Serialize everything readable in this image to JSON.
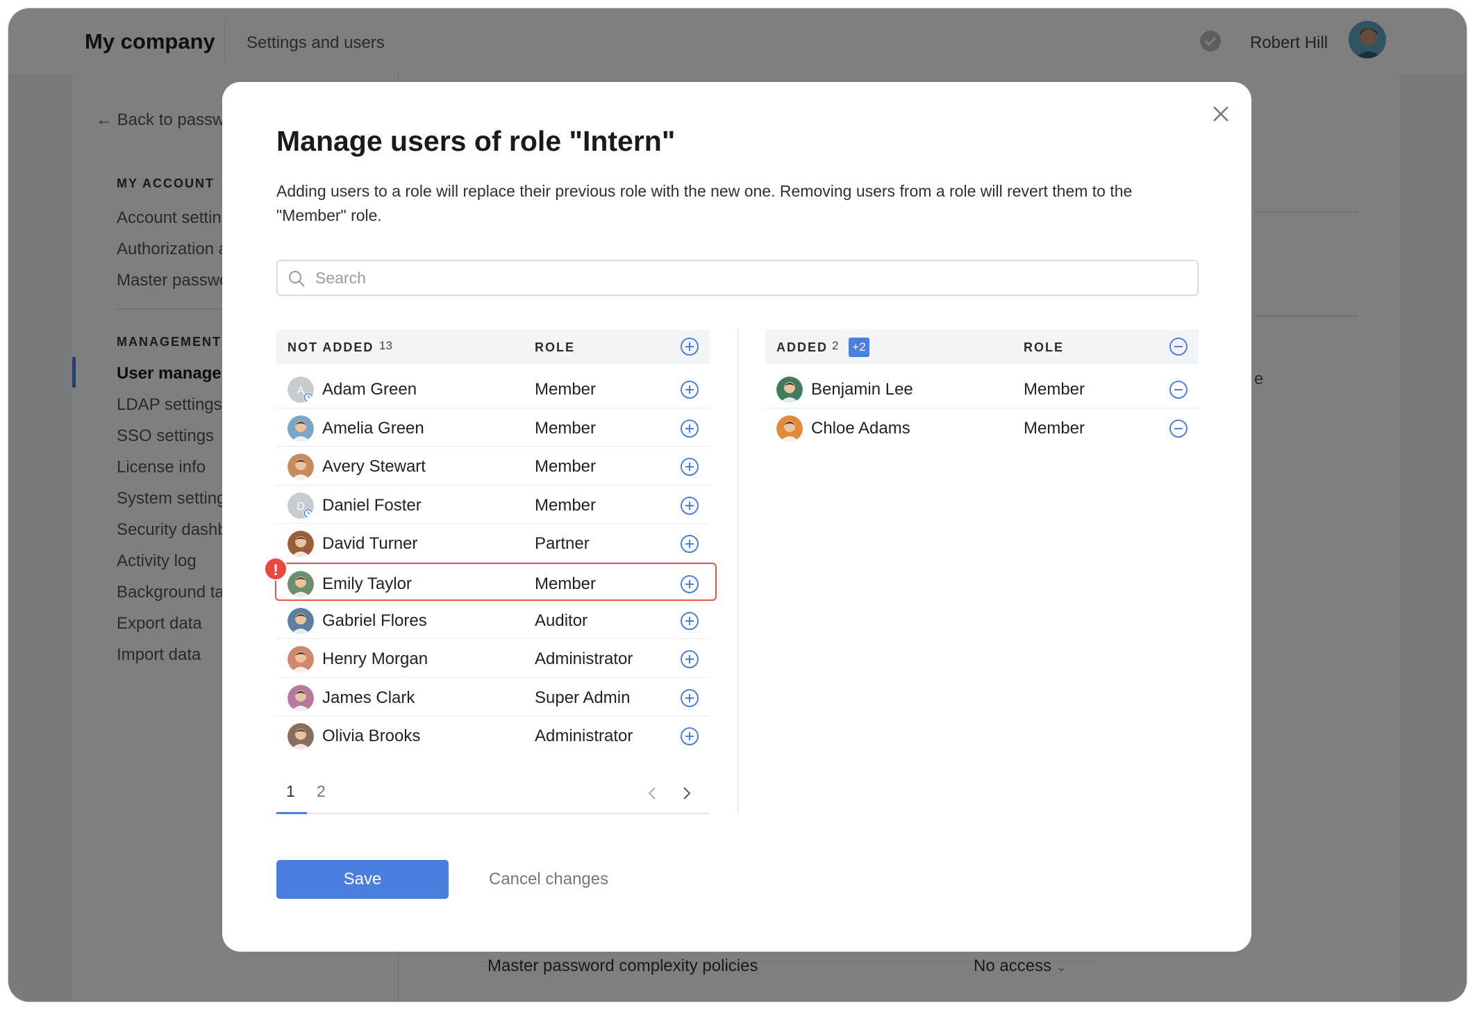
{
  "app": {
    "brand": "My company",
    "breadcrumb": "Settings and users",
    "current_user": "Robert Hill"
  },
  "sidebar": {
    "back_label": "Back to passwo",
    "section_account": "MY ACCOUNT",
    "account_items": [
      "Account settin",
      "Authorization a",
      "Master passwo"
    ],
    "section_management": "MANAGEMENT",
    "management_items": [
      "User managen",
      "LDAP settings",
      "SSO settings",
      "License info",
      "System setting",
      "Security dashb",
      "Activity log",
      "Background ta",
      "Export data",
      "Import data"
    ],
    "active_index": 0
  },
  "background": {
    "partial_text": "e",
    "row_label": "Master password complexity policies",
    "row_value": "No access"
  },
  "modal": {
    "title": "Manage users of role \"Intern\"",
    "description": "Adding users to a role will replace their previous role with the new one. Removing users from a role will revert them to the \"Member\" role.",
    "search_placeholder": "Search",
    "not_added": {
      "label": "NOT ADDED",
      "count": "13",
      "role_header": "ROLE",
      "rows": [
        {
          "name": "Adam Green",
          "role": "Member",
          "avatar": "initial-A",
          "pending": true
        },
        {
          "name": "Amelia Green",
          "role": "Member",
          "avatar": "photo"
        },
        {
          "name": "Avery Stewart",
          "role": "Member",
          "avatar": "photo"
        },
        {
          "name": "Daniel Foster",
          "role": "Member",
          "avatar": "initial-D",
          "pending": true
        },
        {
          "name": "David Turner",
          "role": "Partner",
          "avatar": "photo"
        },
        {
          "name": "Emily Taylor",
          "role": "Member",
          "avatar": "photo",
          "error": true
        },
        {
          "name": "Gabriel Flores",
          "role": "Auditor",
          "avatar": "photo"
        },
        {
          "name": "Henry Morgan",
          "role": "Administrator",
          "avatar": "photo"
        },
        {
          "name": "James Clark",
          "role": "Super Admin",
          "avatar": "photo"
        },
        {
          "name": "Olivia Brooks",
          "role": "Administrator",
          "avatar": "photo"
        }
      ]
    },
    "added": {
      "label": "ADDED",
      "count": "2",
      "badge": "+2",
      "role_header": "ROLE",
      "rows": [
        {
          "name": "Benjamin Lee",
          "role": "Member",
          "avatar": "photo"
        },
        {
          "name": "Chloe Adams",
          "role": "Member",
          "avatar": "photo"
        }
      ]
    },
    "pagination": {
      "pages": [
        "1",
        "2"
      ],
      "current": "1"
    },
    "warning_mark": "!",
    "save_label": "Save",
    "cancel_label": "Cancel changes"
  },
  "colors": {
    "accent": "#4a7fe0",
    "error": "#e5534b",
    "overlay": "rgba(0,0,0,0.5)"
  }
}
